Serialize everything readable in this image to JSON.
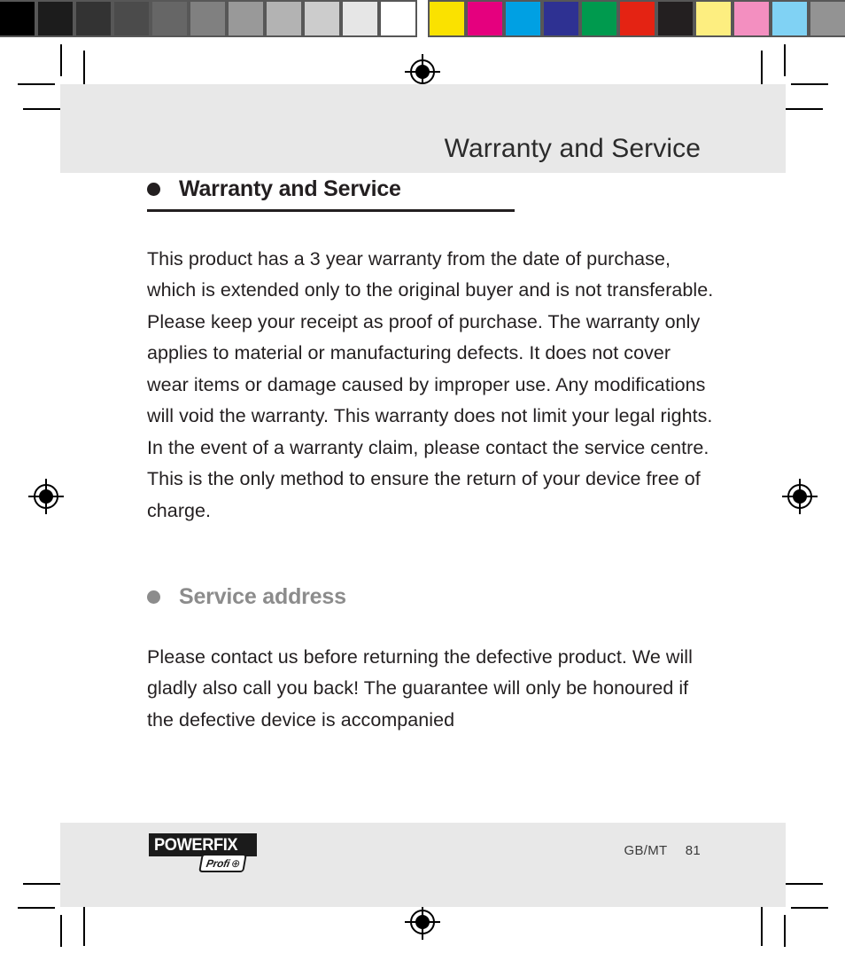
{
  "document": {
    "header_title": "Warranty and Service",
    "footer": {
      "logo_word": "POWERFIX",
      "logo_star": "*",
      "logo_sub": "Profi",
      "logo_sub_mark": "⊕",
      "locale": "GB/MT",
      "page_number": "81"
    }
  },
  "sections": [
    {
      "bullet": "bullet-dot",
      "heading": "Warranty and Service",
      "underlined": true,
      "color": "#231f20",
      "paragraph": "This product has a 3 year warranty from the date of purchase, which is extended only to the original buyer and is not transferable. Please keep your receipt as proof of purchase. The warranty only applies to material or manufacturing defects. It does not cover wear items or damage caused by improper use. Any modifications will void the warranty. This warranty does not limit your legal rights. In the event of a warranty claim, please contact the service centre. This is the only method to ensure the return of your device free of charge."
    },
    {
      "bullet": "bullet-dot",
      "heading": "Service address",
      "underlined": false,
      "color": "#8c8c8c",
      "paragraph": "Please contact us before returning the defective product. We will gladly also call you back! The guarantee will only be honoured if the defective device is accompanied"
    }
  ],
  "calibration_bar": {
    "grayscale": [
      "#000000",
      "#1c1c1c",
      "#333333",
      "#4b4b4b",
      "#666666",
      "#808080",
      "#999999",
      "#b3b3b3",
      "#cccccc",
      "#e6e6e6",
      "#ffffff"
    ],
    "colors": [
      "#fae200",
      "#e5007e",
      "#00a0e3",
      "#2e3192",
      "#009a4e",
      "#e42313",
      "#231f20",
      "#fdee80",
      "#f38fc0",
      "#80d2f4",
      "#939393"
    ],
    "separator_color": "#575757"
  },
  "print_marks": {
    "registration_mark": "registration-target",
    "crop_mark_color": "#000000"
  }
}
